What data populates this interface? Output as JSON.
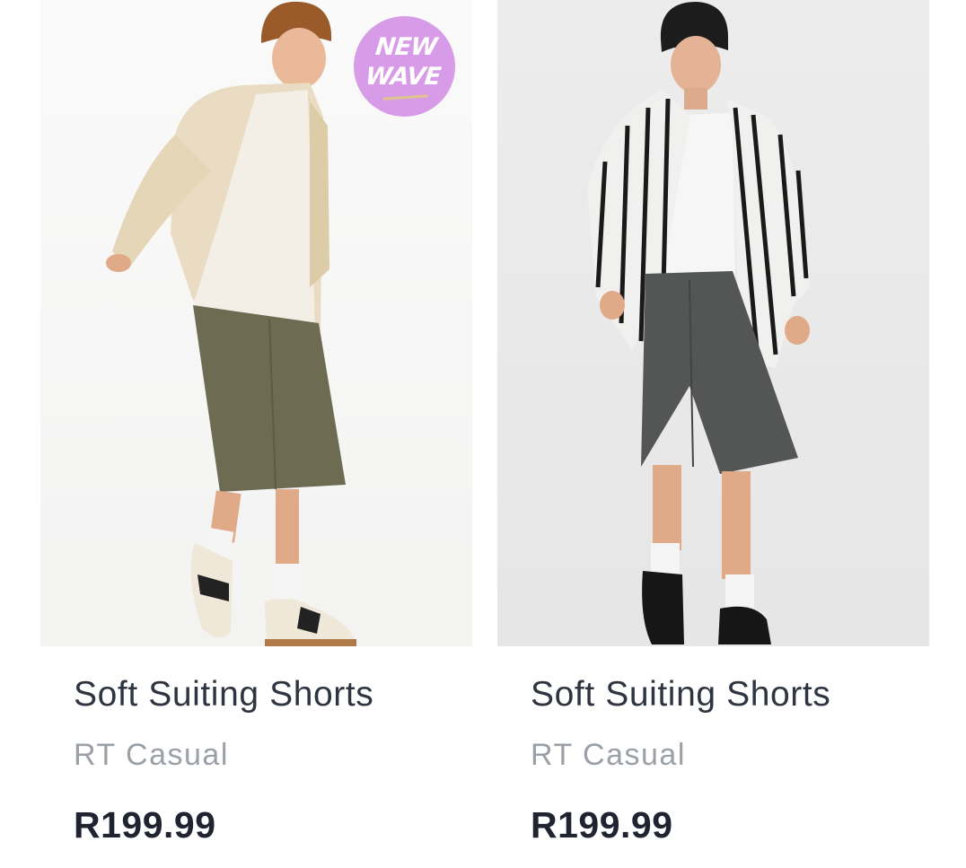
{
  "products": [
    {
      "title": "Soft Suiting Shorts",
      "brand": "RT Casual",
      "price": "R199.99",
      "badge": {
        "line1": "NEW",
        "line2": "WAVE",
        "color": "#d79be7"
      },
      "image": "model-beige-jacket-olive-shorts"
    },
    {
      "title": "Soft Suiting Shorts",
      "brand": "RT Casual",
      "price": "R199.99",
      "image": "model-striped-shirt-grey-shorts"
    }
  ]
}
